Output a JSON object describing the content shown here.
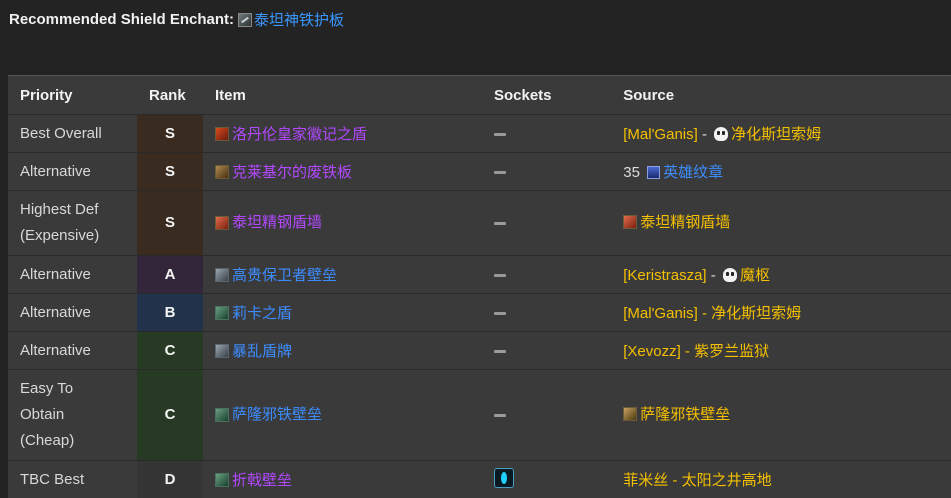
{
  "enchant": {
    "label": "Recommended Shield Enchant",
    "sep": ":",
    "link": "泰坦神铁护板",
    "icon": "shield-plate-icon"
  },
  "table": {
    "headers": [
      "Priority",
      "Rank",
      "Item",
      "Sockets",
      "Source"
    ],
    "rows": [
      {
        "priority": "Best Overall",
        "rank": "S",
        "item": "洛丹伦皇家徽记之盾",
        "quality": "epic",
        "item_icon": "red-shield-icon",
        "socket": "dash",
        "source": [
          {
            "text": "[Mal'Ganis]",
            "color": "gold"
          },
          {
            "text": " - ",
            "color": "white"
          },
          {
            "icon": "skull-icon"
          },
          {
            "text": "净化斯坦索姆",
            "color": "gold"
          }
        ]
      },
      {
        "priority": "Alternative",
        "rank": "S",
        "item": "克莱基尔的废铁板",
        "quality": "epic",
        "item_icon": "brown-shield-icon",
        "socket": "dash",
        "source": [
          {
            "text": "35 ",
            "color": "white"
          },
          {
            "icon": "badge-icon"
          },
          {
            "text": "英雄纹章",
            "color": "blue"
          }
        ]
      },
      {
        "priority": "Highest Def\n(Expensive)",
        "rank": "S",
        "item": "泰坦精钢盾墙",
        "quality": "epic",
        "item_icon": "red-square-shield-icon",
        "socket": "dash",
        "source": [
          {
            "icon": "red-square-shield-icon"
          },
          {
            "text": "泰坦精钢盾墙",
            "color": "gold"
          }
        ]
      },
      {
        "priority": "Alternative",
        "rank": "A",
        "item": "高贵保卫者壁垒",
        "quality": "rare",
        "item_icon": "steel-shield-icon",
        "socket": "dash",
        "source": [
          {
            "text": "[Keristrasza]",
            "color": "gold"
          },
          {
            "text": " - ",
            "color": "white"
          },
          {
            "icon": "skull-icon"
          },
          {
            "text": "魔枢",
            "color": "gold"
          }
        ]
      },
      {
        "priority": "Alternative",
        "rank": "B",
        "item": "莉卡之盾",
        "quality": "rare",
        "item_icon": "green-shield-icon",
        "socket": "dash",
        "source": [
          {
            "text": "[Mal'Ganis] - 净化斯坦索姆",
            "color": "gold"
          }
        ]
      },
      {
        "priority": "Alternative",
        "rank": "C",
        "item": "暴乱盾牌",
        "quality": "rare",
        "item_icon": "steel-shield-icon",
        "socket": "dash",
        "source": [
          {
            "text": "[Xevozz] - 紫罗兰监狱",
            "color": "gold"
          }
        ]
      },
      {
        "priority": "Easy To\nObtain\n(Cheap)",
        "rank": "C",
        "item": "萨隆邪铁壁垒",
        "quality": "rare",
        "item_icon": "green-shield-icon",
        "socket": "dash",
        "source": [
          {
            "icon": "gold-shield-icon"
          },
          {
            "text": "萨隆邪铁壁垒",
            "color": "gold"
          }
        ]
      },
      {
        "priority": "TBC Best",
        "rank": "D",
        "item": "折戟壁垒",
        "quality": "epic",
        "item_icon": "green-shield-icon",
        "socket": "gem-icon",
        "source": [
          {
            "text": "菲米丝 - 太阳之井高地",
            "color": "gold"
          }
        ]
      }
    ]
  },
  "colors": {
    "background": "#232323",
    "table_bg": "#3a3a3a",
    "epic": "#b248ff",
    "rare": "#3c8cff",
    "gold": "#f5c000",
    "rank_S": "#3a2b20",
    "rank_A": "#33263a",
    "rank_B": "#22324a",
    "rank_C": "#263a24",
    "rank_D": "#353535"
  }
}
